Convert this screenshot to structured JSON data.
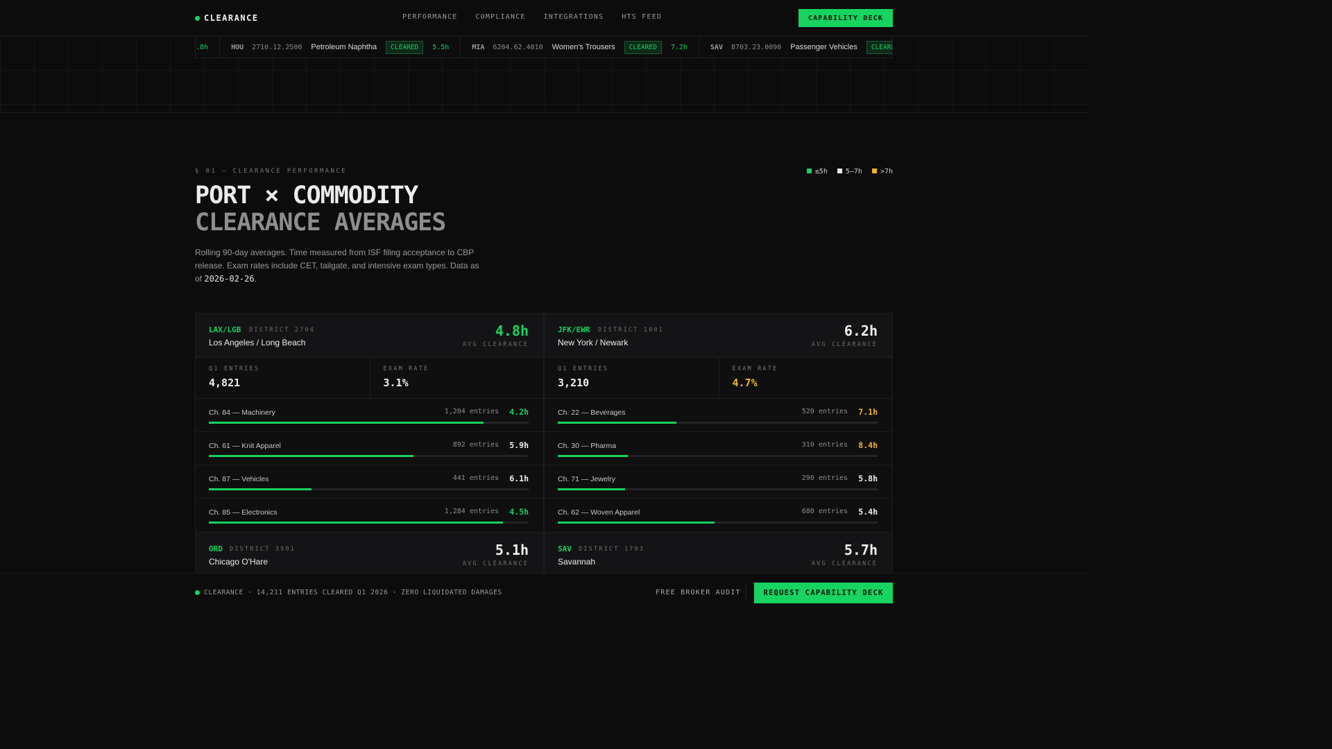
{
  "nav": {
    "brand": "CLEARANCE",
    "links": [
      "PERFORMANCE",
      "COMPLIANCE",
      "INTEGRATIONS",
      "HTS FEED"
    ],
    "cta": "CAPABILITY DECK"
  },
  "ticker": [
    {
      "code": "",
      "hts": "",
      "desc": "",
      "status": "",
      "time": ".8h"
    },
    {
      "code": "HOU",
      "hts": "2710.12.2500",
      "desc": "Petroleum Naphtha",
      "status": "CLEARED",
      "time": "5.5h"
    },
    {
      "code": "MIA",
      "hts": "6204.62.4010",
      "desc": "Women's Trousers",
      "status": "CLEARED",
      "time": "7.2h"
    },
    {
      "code": "SAV",
      "hts": "8703.23.0090",
      "desc": "Passenger Vehicles",
      "status": "CLEARED",
      "time": ""
    }
  ],
  "section": {
    "eyebrow": "§ 01 — CLEARANCE PERFORMANCE",
    "title_line1": "PORT × COMMODITY",
    "title_line2": "CLEARANCE AVERAGES",
    "lede": "Rolling 90-day averages. Time measured from ISF filing acceptance to CBP release. Exam rates include CET, tailgate, and intensive exam types. Data as of ",
    "date": "2026-02-26",
    "period": ".",
    "legend": [
      {
        "label": "≤5h",
        "color": "#17d35f"
      },
      {
        "label": "5–7h",
        "color": "#e6e6e6"
      },
      {
        "label": ">7h",
        "color": "#f0b429"
      }
    ]
  },
  "colors": {
    "fast": "#17d35f",
    "mid": "#f0f0f0",
    "slow": "#f0b429"
  },
  "ports": [
    {
      "code": "LAX/LGB",
      "district": "DISTRICT 2704",
      "name": "Los Angeles / Long Beach",
      "avg": "4.8h",
      "avg_label": "AVG CLEARANCE",
      "entries_label": "Q1 ENTRIES",
      "entries": "4,821",
      "exam_label": "EXAM RATE",
      "exam": "3.1%",
      "commodities": [
        {
          "label": "Ch. 84 — Machinery",
          "entries": "1,204 entries",
          "time": "4.2h",
          "hours": 4.2,
          "fill": 0.86
        },
        {
          "label": "Ch. 61 — Knit Apparel",
          "entries": "892 entries",
          "time": "5.9h",
          "hours": 5.9,
          "fill": 0.64
        },
        {
          "label": "Ch. 87 — Vehicles",
          "entries": "441 entries",
          "time": "6.1h",
          "hours": 6.1,
          "fill": 0.32
        },
        {
          "label": "Ch. 85 — Electronics",
          "entries": "1,284 entries",
          "time": "4.5h",
          "hours": 4.5,
          "fill": 0.92
        }
      ]
    },
    {
      "code": "JFK/EWR",
      "district": "DISTRICT 1001",
      "name": "New York / Newark",
      "avg": "6.2h",
      "avg_label": "AVG CLEARANCE",
      "entries_label": "Q1 ENTRIES",
      "entries": "3,210",
      "exam_label": "EXAM RATE",
      "exam": "4.7%",
      "commodities": [
        {
          "label": "Ch. 22 — Beverages",
          "entries": "520 entries",
          "time": "7.1h",
          "hours": 7.1,
          "fill": 0.37
        },
        {
          "label": "Ch. 30 — Pharma",
          "entries": "310 entries",
          "time": "8.4h",
          "hours": 8.4,
          "fill": 0.22
        },
        {
          "label": "Ch. 71 — Jewelry",
          "entries": "290 entries",
          "time": "5.8h",
          "hours": 5.8,
          "fill": 0.21
        },
        {
          "label": "Ch. 62 — Woven Apparel",
          "entries": "680 entries",
          "time": "5.4h",
          "hours": 5.4,
          "fill": 0.49
        }
      ]
    },
    {
      "code": "ORD",
      "district": "DISTRICT 3901",
      "name": "Chicago O'Hare",
      "avg": "5.1h",
      "avg_label": "AVG CLEARANCE"
    },
    {
      "code": "SAV",
      "district": "DISTRICT 1703",
      "name": "Savannah",
      "avg": "5.7h",
      "avg_label": "AVG CLEARANCE"
    }
  ],
  "footer": {
    "summary": "CLEARANCE · 14,211 ENTRIES CLEARED Q1 2026 · ZERO LIQUIDATED DAMAGES",
    "audit": "FREE BROKER AUDIT",
    "cta": "REQUEST CAPABILITY DECK"
  }
}
